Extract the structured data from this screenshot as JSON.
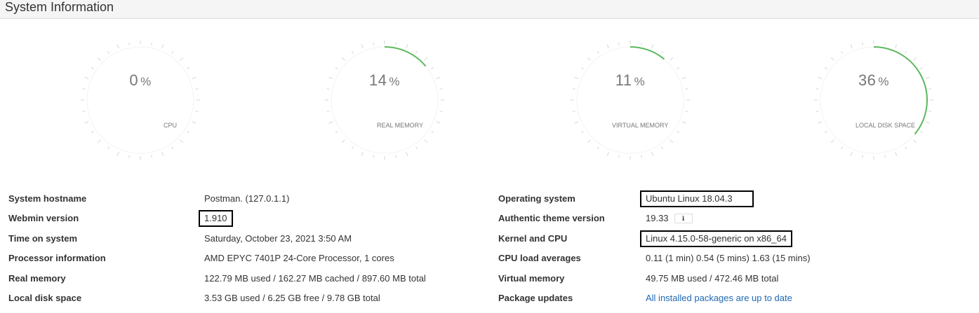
{
  "header": {
    "title": "System Information"
  },
  "gauges": [
    {
      "label": "CPU",
      "value": 0
    },
    {
      "label": "REAL MEMORY",
      "value": 14
    },
    {
      "label": "VIRTUAL MEMORY",
      "value": 11
    },
    {
      "label": "LOCAL DISK SPACE",
      "value": 36
    }
  ],
  "percent_sign": "%",
  "accent_color": "#5cb85c",
  "info_left": [
    {
      "label": "System hostname",
      "value": "Postman. (127.0.1.1)"
    },
    {
      "label": "Webmin version",
      "value": "1.910"
    },
    {
      "label": "Time on system",
      "value": "Saturday, October 23, 2021 3:50 AM"
    },
    {
      "label": "Processor information",
      "value": "AMD EPYC 7401P 24-Core Processor, 1 cores"
    },
    {
      "label": "Real memory",
      "value": "122.79 MB used / 162.27 MB cached / 897.60 MB total"
    },
    {
      "label": "Local disk space",
      "value": "3.53 GB used / 6.25 GB free / 9.78 GB total"
    }
  ],
  "info_right": [
    {
      "label": "Operating system",
      "value": "Ubuntu Linux 18.04.3"
    },
    {
      "label": "Authentic theme version",
      "value": "19.33"
    },
    {
      "label": "Kernel and CPU",
      "value": "Linux 4.15.0-58-generic on x86_64"
    },
    {
      "label": "CPU load averages",
      "value": "0.11 (1 min) 0.54 (5 mins) 1.63 (15 mins)"
    },
    {
      "label": "Virtual memory",
      "value": "49.75 MB used / 472.46 MB total"
    },
    {
      "label": "Package updates",
      "value": "All installed packages are up to date"
    }
  ]
}
